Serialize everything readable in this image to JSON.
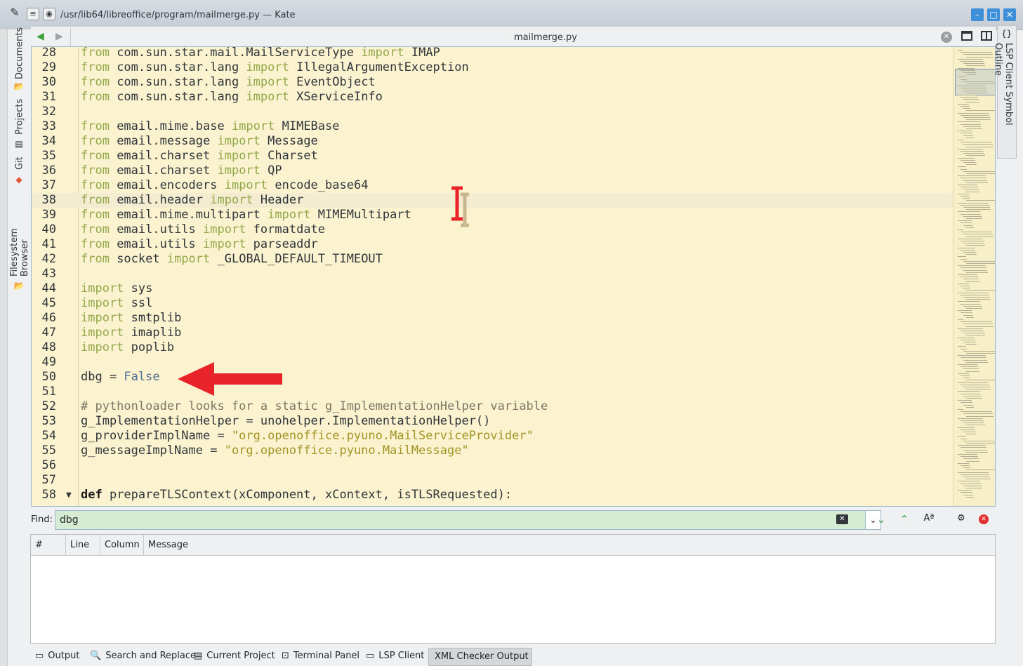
{
  "window": {
    "title": "/usr/lib64/libreoffice/program/mailmerge.py — Kate"
  },
  "tab": {
    "name": "mailmerge.py"
  },
  "sidebar_left": {
    "tabs": [
      "Documents",
      "Projects",
      "Git",
      "Filesystem Browser"
    ]
  },
  "sidebar_right": {
    "tab": "LSP Client Symbol Outline"
  },
  "editor": {
    "lines": [
      {
        "n": "28",
        "tokens": [
          [
            "kw",
            "from"
          ],
          [
            "t",
            " com.sun.star.mail.MailServiceType "
          ],
          [
            "kw",
            "import"
          ],
          [
            "t",
            " IMAP"
          ]
        ]
      },
      {
        "n": "29",
        "tokens": [
          [
            "kw",
            "from"
          ],
          [
            "t",
            " com.sun.star.lang "
          ],
          [
            "kw",
            "import"
          ],
          [
            "t",
            " IllegalArgumentException"
          ]
        ]
      },
      {
        "n": "30",
        "tokens": [
          [
            "kw",
            "from"
          ],
          [
            "t",
            " com.sun.star.lang "
          ],
          [
            "kw",
            "import"
          ],
          [
            "t",
            " EventObject"
          ]
        ]
      },
      {
        "n": "31",
        "tokens": [
          [
            "kw",
            "from"
          ],
          [
            "t",
            " com.sun.star.lang "
          ],
          [
            "kw",
            "import"
          ],
          [
            "t",
            " XServiceInfo"
          ]
        ]
      },
      {
        "n": "32",
        "tokens": []
      },
      {
        "n": "33",
        "tokens": [
          [
            "kw",
            "from"
          ],
          [
            "t",
            " email.mime.base "
          ],
          [
            "kw",
            "import"
          ],
          [
            "t",
            " MIMEBase"
          ]
        ]
      },
      {
        "n": "34",
        "tokens": [
          [
            "kw",
            "from"
          ],
          [
            "t",
            " email.message "
          ],
          [
            "kw",
            "import"
          ],
          [
            "t",
            " Message"
          ]
        ]
      },
      {
        "n": "35",
        "tokens": [
          [
            "kw",
            "from"
          ],
          [
            "t",
            " email.charset "
          ],
          [
            "kw",
            "import"
          ],
          [
            "t",
            " Charset"
          ]
        ]
      },
      {
        "n": "36",
        "tokens": [
          [
            "kw",
            "from"
          ],
          [
            "t",
            " email.charset "
          ],
          [
            "kw",
            "import"
          ],
          [
            "t",
            " QP"
          ]
        ]
      },
      {
        "n": "37",
        "tokens": [
          [
            "kw",
            "from"
          ],
          [
            "t",
            " email.encoders "
          ],
          [
            "kw",
            "import"
          ],
          [
            "t",
            " encode_base64"
          ]
        ]
      },
      {
        "n": "38",
        "tokens": [
          [
            "kw",
            "from"
          ],
          [
            "t",
            " email.header "
          ],
          [
            "kw",
            "import"
          ],
          [
            "t",
            " Header"
          ]
        ],
        "current": true
      },
      {
        "n": "39",
        "tokens": [
          [
            "kw",
            "from"
          ],
          [
            "t",
            " email.mime.multipart "
          ],
          [
            "kw",
            "import"
          ],
          [
            "t",
            " MIMEMultipart"
          ]
        ]
      },
      {
        "n": "40",
        "tokens": [
          [
            "kw",
            "from"
          ],
          [
            "t",
            " email.utils "
          ],
          [
            "kw",
            "import"
          ],
          [
            "t",
            " formatdate"
          ]
        ]
      },
      {
        "n": "41",
        "tokens": [
          [
            "kw",
            "from"
          ],
          [
            "t",
            " email.utils "
          ],
          [
            "kw",
            "import"
          ],
          [
            "t",
            " parseaddr"
          ]
        ]
      },
      {
        "n": "42",
        "tokens": [
          [
            "kw",
            "from"
          ],
          [
            "t",
            " socket "
          ],
          [
            "kw",
            "import"
          ],
          [
            "t",
            " _GLOBAL_DEFAULT_TIMEOUT"
          ]
        ]
      },
      {
        "n": "43",
        "tokens": []
      },
      {
        "n": "44",
        "tokens": [
          [
            "kw",
            "import"
          ],
          [
            "t",
            " sys"
          ]
        ]
      },
      {
        "n": "45",
        "tokens": [
          [
            "kw",
            "import"
          ],
          [
            "t",
            " ssl"
          ]
        ]
      },
      {
        "n": "46",
        "tokens": [
          [
            "kw",
            "import"
          ],
          [
            "t",
            " smtplib"
          ]
        ]
      },
      {
        "n": "47",
        "tokens": [
          [
            "kw",
            "import"
          ],
          [
            "t",
            " imaplib"
          ]
        ]
      },
      {
        "n": "48",
        "tokens": [
          [
            "kw",
            "import"
          ],
          [
            "t",
            " poplib"
          ]
        ]
      },
      {
        "n": "49",
        "tokens": []
      },
      {
        "n": "50",
        "tokens": [
          [
            "t",
            "dbg = "
          ],
          [
            "bool",
            "False"
          ]
        ]
      },
      {
        "n": "51",
        "tokens": []
      },
      {
        "n": "52",
        "tokens": [
          [
            "cmt",
            "# pythonloader looks for a static g_ImplementationHelper variable"
          ]
        ]
      },
      {
        "n": "53",
        "tokens": [
          [
            "t",
            "g_ImplementationHelper = unohelper.ImplementationHelper()"
          ]
        ]
      },
      {
        "n": "54",
        "tokens": [
          [
            "t",
            "g_providerImplName = "
          ],
          [
            "str",
            "\"org.openoffice.pyuno.MailServiceProvider\""
          ]
        ]
      },
      {
        "n": "55",
        "tokens": [
          [
            "t",
            "g_messageImplName = "
          ],
          [
            "str",
            "\"org.openoffice.pyuno.MailMessage\""
          ]
        ]
      },
      {
        "n": "56",
        "tokens": []
      },
      {
        "n": "57",
        "tokens": []
      },
      {
        "n": "58",
        "tokens": [
          [
            "kwb",
            "def"
          ],
          [
            "t",
            " prepareTLSContext(xComponent, xContext, isTLSRequested):"
          ]
        ],
        "fold": true
      }
    ]
  },
  "find": {
    "label": "Find:",
    "value": "dbg"
  },
  "messages": {
    "columns": [
      "#",
      "Line",
      "Column",
      "Message"
    ]
  },
  "bottom_tabs": [
    {
      "label": "Output",
      "icon": "output-icon"
    },
    {
      "label": "Search and Replace",
      "icon": "search-icon"
    },
    {
      "label": "Current Project",
      "icon": "project-icon"
    },
    {
      "label": "Terminal Panel",
      "icon": "terminal-icon"
    },
    {
      "label": "LSP Client",
      "icon": "lsp-icon"
    },
    {
      "label": "XML Checker Output",
      "icon": "",
      "active": true
    }
  ],
  "colors": {
    "editor_bg": "#fbf2cf",
    "keyword": "#93a84a",
    "string": "#a39426",
    "find_bg": "#d6ecd2",
    "annotation_red": "#e8242a"
  }
}
